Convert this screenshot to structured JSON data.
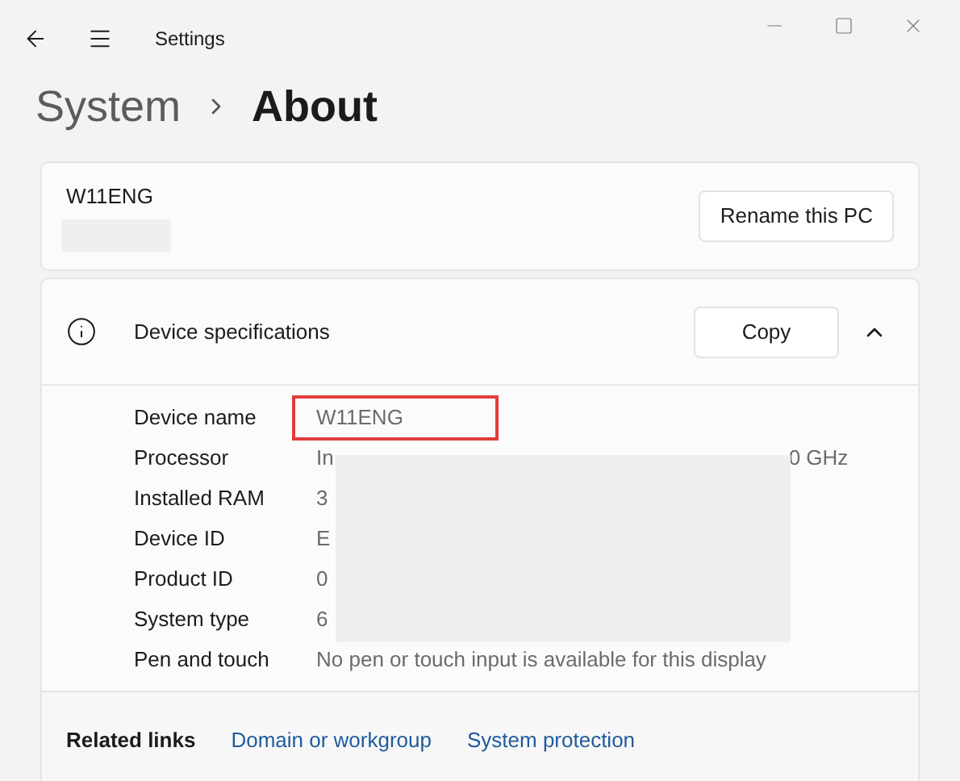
{
  "window": {
    "title": "Settings"
  },
  "breadcrumb": [
    {
      "label": "System",
      "current": false
    },
    {
      "label": "About",
      "current": true
    }
  ],
  "pc_card": {
    "name": "W11ENG",
    "button": "Rename this PC"
  },
  "device_specs": {
    "title": "Device specifications",
    "copy_button": "Copy",
    "expanded": true,
    "rows": [
      {
        "label": "Device name",
        "value": "W11ENG",
        "highlighted": true
      },
      {
        "label": "Processor",
        "value": "In",
        "value_tail": "0 GHz",
        "highlighted": false
      },
      {
        "label": "Installed RAM",
        "value": "3",
        "highlighted": false
      },
      {
        "label": "Device ID",
        "value": "E",
        "highlighted": false
      },
      {
        "label": "Product ID",
        "value": "0",
        "highlighted": false
      },
      {
        "label": "System type",
        "value": "6",
        "highlighted": false
      },
      {
        "label": "Pen and touch",
        "value": "No pen or touch input is available for this display",
        "highlighted": false
      }
    ]
  },
  "related_links": {
    "label": "Related links",
    "links": [
      "Domain or workgroup",
      "System protection"
    ]
  }
}
